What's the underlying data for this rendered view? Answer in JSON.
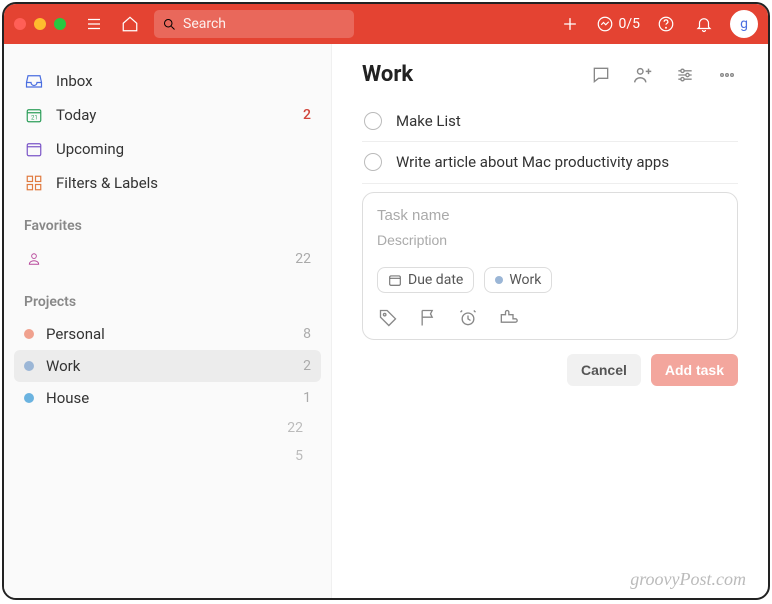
{
  "toolbar": {
    "search_placeholder": "Search",
    "productivity": "0/5",
    "avatar_initial": "g"
  },
  "sidebar": {
    "nav": [
      {
        "key": "inbox",
        "label": "Inbox",
        "count": ""
      },
      {
        "key": "today",
        "label": "Today",
        "count": "2",
        "red": true
      },
      {
        "key": "upcoming",
        "label": "Upcoming",
        "count": ""
      },
      {
        "key": "filters",
        "label": "Filters & Labels",
        "count": ""
      }
    ],
    "favorites_header": "Favorites",
    "favorites": [
      {
        "label": "",
        "count": "22"
      }
    ],
    "projects_header": "Projects",
    "projects": [
      {
        "label": "Personal",
        "count": "8",
        "color": "#f0a18e"
      },
      {
        "label": "Work",
        "count": "2",
        "color": "#9bb6d6",
        "selected": true
      },
      {
        "label": "House",
        "count": "1",
        "color": "#6bb3e0"
      }
    ],
    "trailing": [
      "22",
      "5"
    ]
  },
  "main": {
    "title": "Work",
    "tasks": [
      "Make List",
      "Write article about Mac productivity apps"
    ],
    "new_task": {
      "name_placeholder": "Task name",
      "desc_placeholder": "Description",
      "due_label": "Due date",
      "project_label": "Work"
    },
    "buttons": {
      "cancel": "Cancel",
      "add": "Add task"
    }
  },
  "watermark": "groovyPost.com"
}
